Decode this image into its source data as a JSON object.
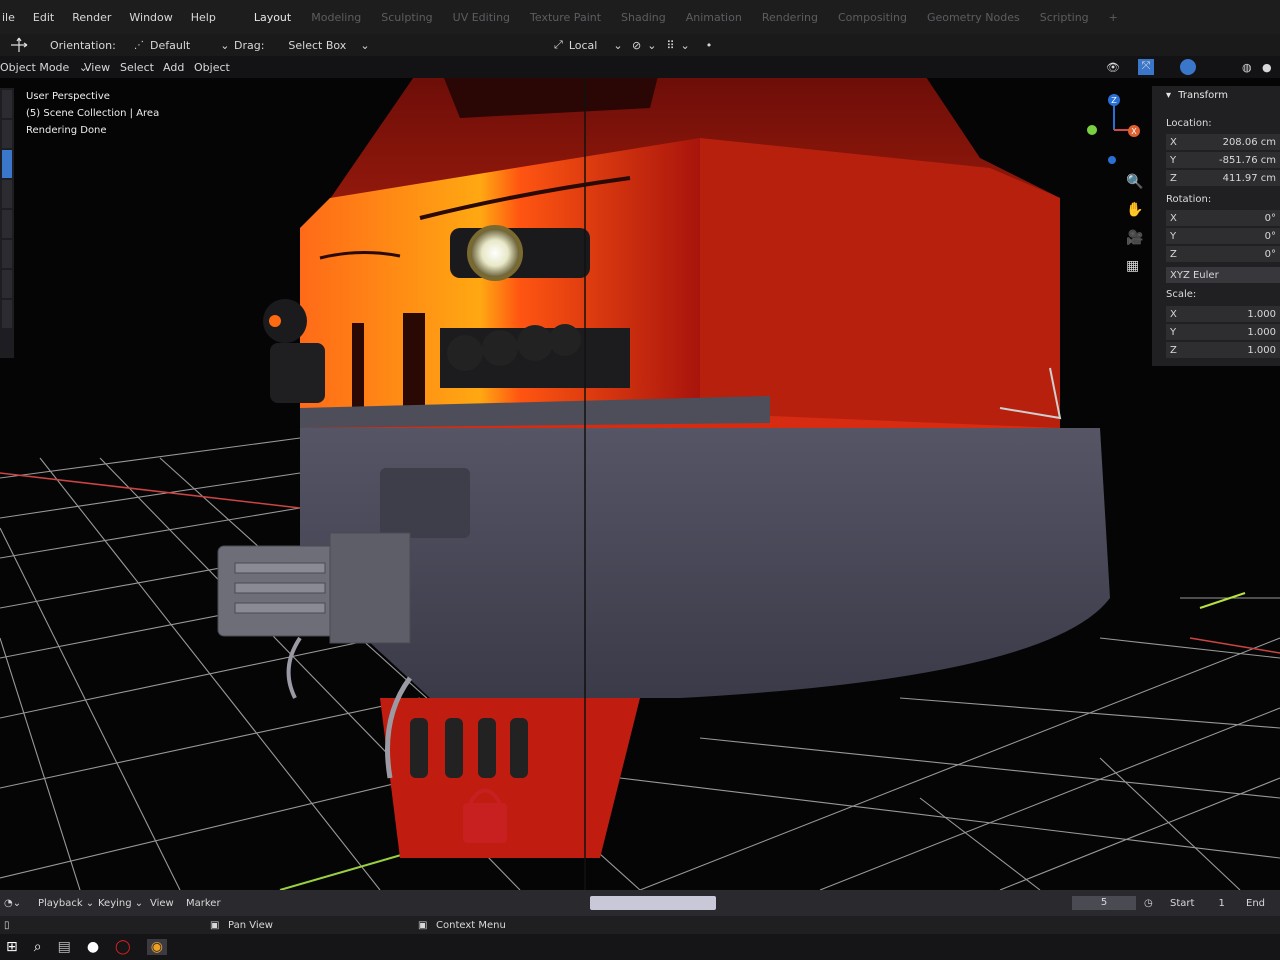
{
  "topbar": {
    "menu": [
      "ile",
      "Edit",
      "Render",
      "Window",
      "Help"
    ],
    "workspaces": [
      "Layout",
      "Modeling",
      "Sculpting",
      "UV Editing",
      "Texture Paint",
      "Shading",
      "Animation",
      "Rendering",
      "Compositing",
      "Geometry Nodes",
      "Scripting"
    ],
    "active_workspace": "Layout"
  },
  "toolbar": {
    "orientation_label": "Orientation:",
    "orientation_value": "Default",
    "drag_label": "Drag:",
    "drag_value": "Select Box",
    "transform_space": "Local"
  },
  "header": {
    "mode": "Object Mode",
    "menus": [
      "View",
      "Select",
      "Add",
      "Object"
    ]
  },
  "viewport_overlay": {
    "line1": "User Perspective",
    "line2": "(5) Scene Collection | Area",
    "line3": "Rendering Done"
  },
  "npanel": {
    "section": "Transform",
    "location_label": "Location:",
    "location": [
      {
        "axis": "X",
        "value": "208.06 cm"
      },
      {
        "axis": "Y",
        "value": "-851.76 cm"
      },
      {
        "axis": "Z",
        "value": "411.97 cm"
      }
    ],
    "rotation_label": "Rotation:",
    "rotation": [
      {
        "axis": "X",
        "value": "0°"
      },
      {
        "axis": "Y",
        "value": "0°"
      },
      {
        "axis": "Z",
        "value": "0°"
      }
    ],
    "rotation_mode": "XYZ Euler",
    "scale_label": "Scale:",
    "scale": [
      {
        "axis": "X",
        "value": "1.000"
      },
      {
        "axis": "Y",
        "value": "1.000"
      },
      {
        "axis": "Z",
        "value": "1.000"
      }
    ]
  },
  "gizmo": {
    "z_label": "Z",
    "x_label": "X",
    "icons": [
      "zoom-icon",
      "hand-pan-icon",
      "camera-icon",
      "grid-ortho-icon"
    ]
  },
  "timeline": {
    "menus": [
      "Playback",
      "Keying",
      "View",
      "Marker"
    ],
    "current_frame": "5",
    "start_label": "Start",
    "start_value": "1",
    "end_label": "End"
  },
  "status": {
    "pan_view": "Pan View",
    "context_menu": "Context Menu"
  },
  "colors": {
    "accent": "#3a76c9",
    "locomotive_orange": "#ff5a10",
    "locomotive_yellow": "#ffb010",
    "locomotive_red": "#c81c10",
    "body_gray": "#4a4a58",
    "axis_x": "#d04848",
    "axis_y": "#7ad040",
    "axis_z": "#2a6fd6"
  }
}
